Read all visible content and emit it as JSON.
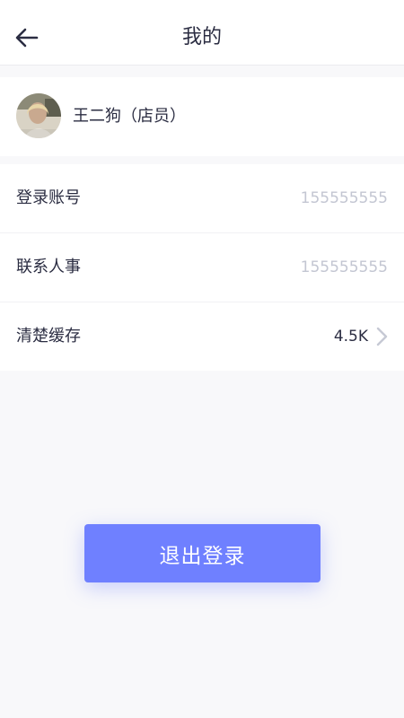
{
  "header": {
    "title": "我的",
    "back_icon": "arrow-left-icon"
  },
  "profile": {
    "name": "王二狗（店员）",
    "avatar": "avatar-photo"
  },
  "settings": {
    "items": [
      {
        "label": "登录账号",
        "value": "155555555"
      },
      {
        "label": "联系人事",
        "value": "155555555"
      },
      {
        "label": "清楚缓存",
        "value": "4.5K",
        "icon": "chevron-right-icon"
      }
    ]
  },
  "actions": {
    "logout_label": "退出登录"
  },
  "colors": {
    "accent": "#6f80ff",
    "text_primary": "#2b2d42",
    "text_muted": "#c3c6d2",
    "background": "#f8f8fa"
  }
}
